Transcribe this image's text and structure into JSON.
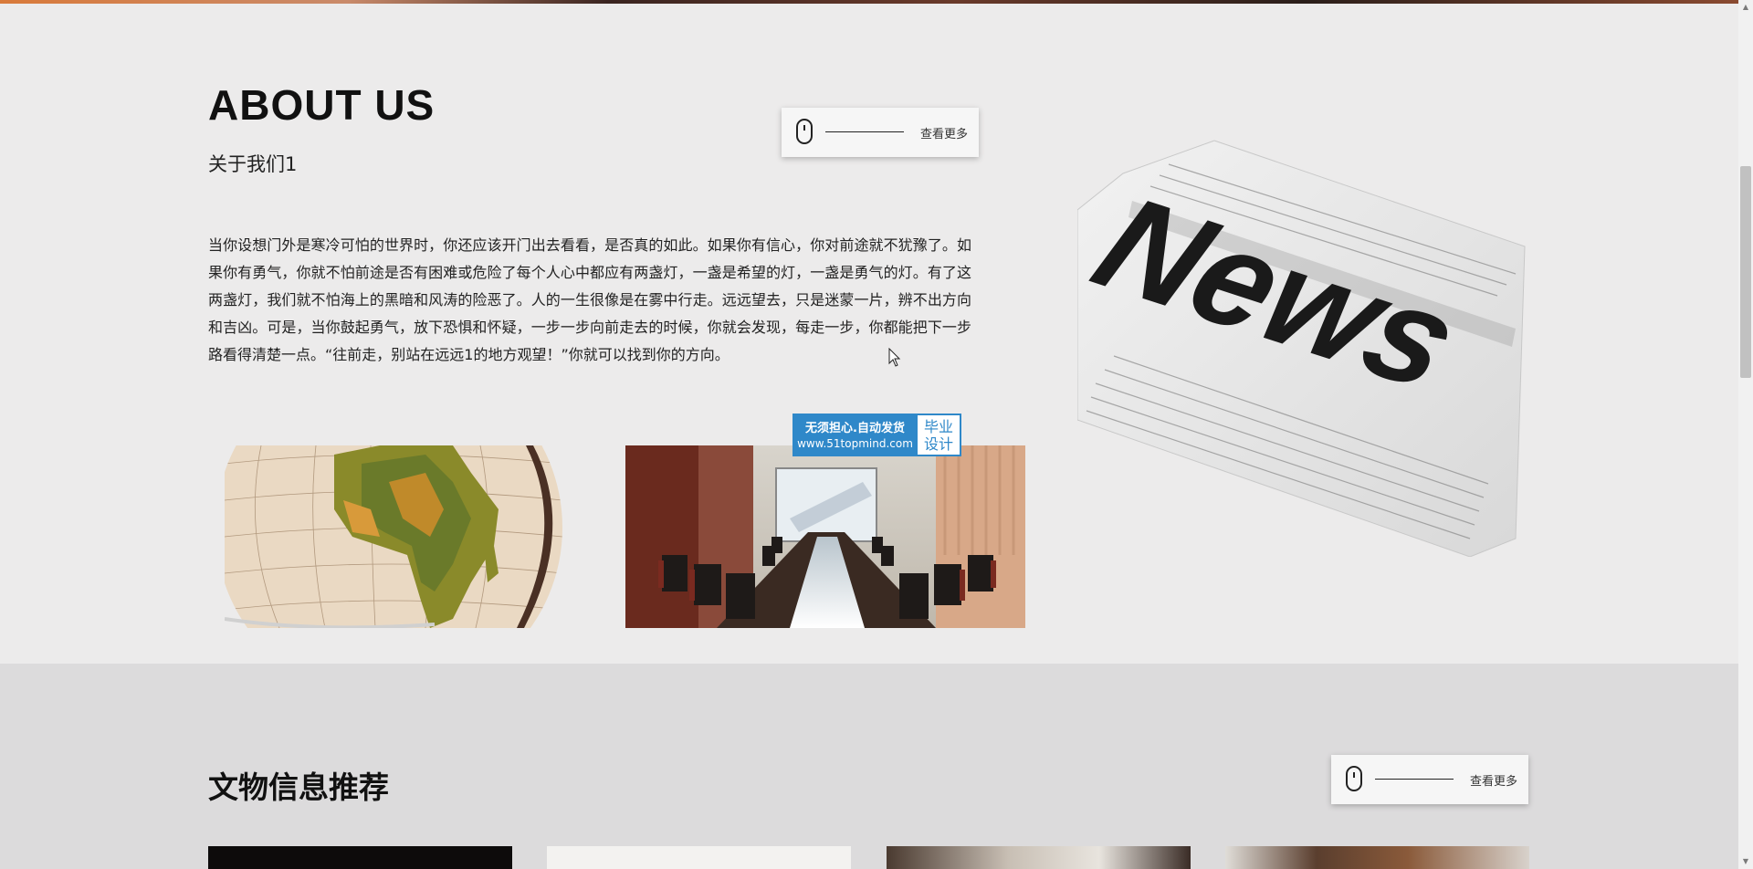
{
  "about": {
    "title": "ABOUT US",
    "subtitle": "关于我们1",
    "body": "当你设想门外是寒冷可怕的世界时，你还应该开门出去看看，是否真的如此。如果你有信心，你对前途就不犹豫了。如果你有勇气，你就不怕前途是否有困难或危险了每个人心中都应有两盏灯，一盏是希望的灯，一盏是勇气的灯。有了这两盏灯，我们就不怕海上的黑暗和风涛的险恶了。人的一生很像是在雾中行走。远远望去，只是迷蒙一片，辨不出方向和吉凶。可是，当你鼓起勇气，放下恐惧和怀疑，一步一步向前走去的时候，你就会发现，每走一步，你都能把下一步路看得清楚一点。“往前走，别站在远远1的地方观望！”你就可以找到你的方向。",
    "more_label": "查看更多"
  },
  "badge": {
    "line1": "无须担心.自动发货",
    "line2": "www.51topmind.com",
    "right": "毕业设计"
  },
  "news_image": {
    "headline": "News"
  },
  "recommend": {
    "title": "文物信息推荐",
    "more_label": "查看更多"
  },
  "colors": {
    "badge_blue": "#2f88c9",
    "page_bg": "#ecebeb",
    "section2_bg": "#dcdbdc"
  }
}
